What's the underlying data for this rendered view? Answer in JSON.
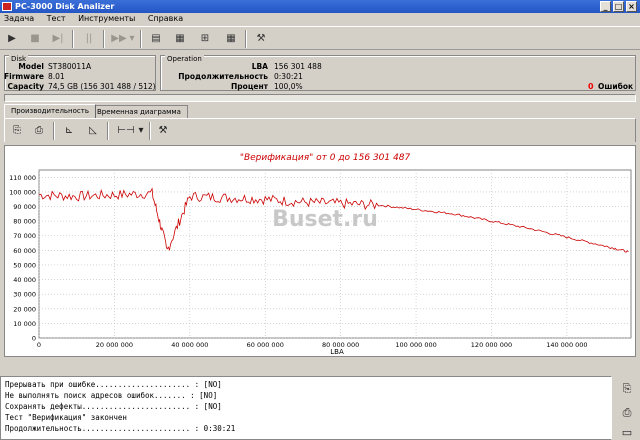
{
  "window": {
    "title": "PC-3000 Disk Analizer",
    "controls": [
      "_",
      "□",
      "×"
    ]
  },
  "menu": [
    "Задача",
    "Тест",
    "Инструменты",
    "Справка"
  ],
  "disk": {
    "group_title": "Disk",
    "model_label": "Model",
    "model": "ST380011A",
    "firmware_label": "Firmware",
    "firmware": "8.01",
    "capacity_label": "Capacity",
    "capacity": "74,5 GB (156 301 488 / 512)"
  },
  "operation": {
    "group_title": "Operation",
    "lba_label": "LBA",
    "lba": "156 301 488",
    "duration_label": "Продолжительность",
    "duration": "0:30:21",
    "percent_label": "Процент",
    "percent": "100,0%",
    "errors_count": "0",
    "errors_label": "Ошибок"
  },
  "tabs": [
    "Производительность",
    "Временная диаграмма"
  ],
  "chart_data": {
    "type": "line",
    "title": "\"Верификация\" от 0 до 156 301 487",
    "xlabel": "LBA",
    "ylabel": "",
    "xlim": [
      0,
      157000000
    ],
    "ylim": [
      0,
      115000
    ],
    "x_ticks": [
      "0",
      "20 000 000",
      "40 000 000",
      "60 000 000",
      "80 000 000",
      "100 000 000",
      "120 000 000",
      "140 000 000"
    ],
    "y_ticks": [
      "0",
      "10 000",
      "20 000",
      "30 000",
      "40 000",
      "50 000",
      "60 000",
      "70 000",
      "80 000",
      "90 000",
      "100 000",
      "110 000"
    ],
    "grid": true,
    "color": "#cc0000",
    "series": [
      {
        "x": [
          0,
          10000000,
          20000000,
          30000000,
          34000000,
          40000000,
          50000000,
          60000000,
          70000000,
          80000000,
          90000000,
          100000000,
          110000000,
          120000000,
          130000000,
          140000000,
          150000000,
          156301487
        ],
        "y": [
          98000,
          97000,
          98000,
          99000,
          60000,
          97000,
          96000,
          95000,
          93000,
          92000,
          91000,
          88000,
          85000,
          80000,
          75000,
          69000,
          63000,
          59000
        ]
      }
    ]
  },
  "log_lines": [
    "Прерывать при ошибке..................... : [NO]",
    "Не выполнять поиск адресов ошибок....... : [NO]",
    "Сохранять дефекты........................ : [NO]",
    "Тест \"Верификация\" закончен",
    "Продолжительность........................ : 0:30:21"
  ],
  "watermark": "Buset.ru"
}
